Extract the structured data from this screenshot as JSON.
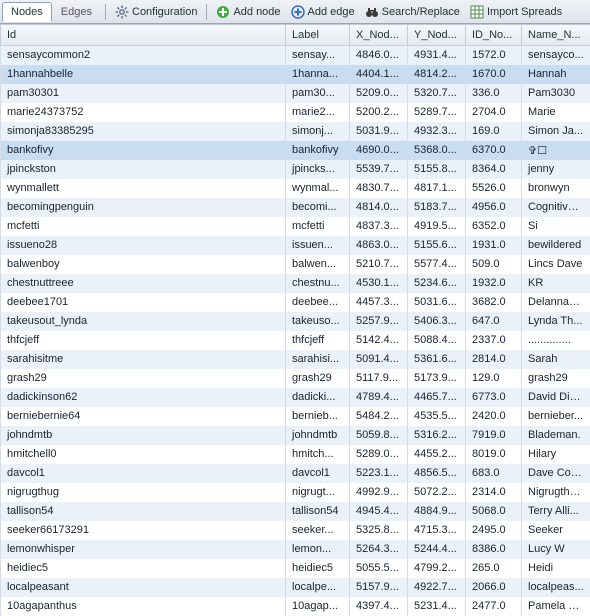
{
  "toolbar": {
    "tabs": {
      "nodes": "Nodes",
      "edges": "Edges"
    },
    "config": "Configuration",
    "addNode": "Add node",
    "addEdge": "Add edge",
    "search": "Search/Replace",
    "import": "Import Spreads"
  },
  "columns": {
    "id": "Id",
    "label": "Label",
    "x": "X_Nod...",
    "y": "Y_Nod...",
    "idno": "ID_No...",
    "name": "Name_N..."
  },
  "rows": [
    {
      "id": "sensaycommon2",
      "label": "sensay...",
      "x": "4846.0...",
      "y": "4931.4...",
      "idno": "1572.0",
      "name": "sensayco..."
    },
    {
      "id": "1hannahbelle",
      "label": "1hanna...",
      "x": "4404.1...",
      "y": "4814.2...",
      "idno": "1670.0",
      "name": "Hannah"
    },
    {
      "id": "pam30301",
      "label": "pam30...",
      "x": "5209.0...",
      "y": "5320.7...",
      "idno": "336.0",
      "name": "Pam3030"
    },
    {
      "id": "marie24373752",
      "label": "marie2...",
      "x": "5200.2...",
      "y": "5289.7...",
      "idno": "2704.0",
      "name": "Marie"
    },
    {
      "id": "simonja83385295",
      "label": "simonj...",
      "x": "5031.9...",
      "y": "4932.3...",
      "idno": "169.0",
      "name": "Simon Ja..."
    },
    {
      "id": "bankofivy",
      "label": "bankofivy",
      "x": "4690.0...",
      "y": "5368.0...",
      "idno": "6370.0",
      "name": "✞☐"
    },
    {
      "id": "jpinckston",
      "label": "jpincks...",
      "x": "5539.7...",
      "y": "5155.8...",
      "idno": "8364.0",
      "name": "jenny"
    },
    {
      "id": "wynmallett",
      "label": "wynmal...",
      "x": "4830.7...",
      "y": "4817.1...",
      "idno": "5526.0",
      "name": "bronwyn"
    },
    {
      "id": "becomingpenguin",
      "label": "becomi...",
      "x": "4814.0...",
      "y": "5183.7...",
      "idno": "4956.0",
      "name": "Cognitive ..."
    },
    {
      "id": "mcfetti",
      "label": "mcfetti",
      "x": "4837.3...",
      "y": "4919.5...",
      "idno": "6352.0",
      "name": "Si"
    },
    {
      "id": "issueno28",
      "label": "issuen...",
      "x": "4863.0...",
      "y": "5155.6...",
      "idno": "1931.0",
      "name": "bewildered"
    },
    {
      "id": "balwenboy",
      "label": "balwen...",
      "x": "5210.7...",
      "y": "5577.4...",
      "idno": "509.0",
      "name": "Lincs Dave"
    },
    {
      "id": "chestnuttreee",
      "label": "chestnu...",
      "x": "4530.1...",
      "y": "5234.6...",
      "idno": "1932.0",
      "name": "KR"
    },
    {
      "id": "deebee1701",
      "label": "deebee...",
      "x": "4457.3...",
      "y": "5031.6...",
      "idno": "3682.0",
      "name": "DelannaM..."
    },
    {
      "id": "takeusout_lynda",
      "label": "takeuso...",
      "x": "5257.9...",
      "y": "5406.3...",
      "idno": "647.0",
      "name": "Lynda Th..."
    },
    {
      "id": "thfcjeff",
      "label": "thfcjeff",
      "x": "5142.4...",
      "y": "5088.4...",
      "idno": "2337.0",
      "name": ".............."
    },
    {
      "id": "sarahisitme",
      "label": "sarahisi...",
      "x": "5091.4...",
      "y": "5361.6...",
      "idno": "2814.0",
      "name": "Sarah"
    },
    {
      "id": "grash29",
      "label": "grash29",
      "x": "5117.9...",
      "y": "5173.9...",
      "idno": "129.0",
      "name": "grash29"
    },
    {
      "id": "dadickinson62",
      "label": "dadicki...",
      "x": "4789.4...",
      "y": "4465.7...",
      "idno": "6773.0",
      "name": "David Dic..."
    },
    {
      "id": "berniebernie64",
      "label": "bernieb...",
      "x": "5484.2...",
      "y": "4535.5...",
      "idno": "2420.0",
      "name": "bernieber..."
    },
    {
      "id": "johndmtb",
      "label": "johndmtb",
      "x": "5059.8...",
      "y": "5316.2...",
      "idno": "7919.0",
      "name": "Blademan."
    },
    {
      "id": "hmitchell0",
      "label": "hmitch...",
      "x": "5289.0...",
      "y": "4455.2...",
      "idno": "8019.0",
      "name": "Hilary"
    },
    {
      "id": "davcol1",
      "label": "davcol1",
      "x": "5223.1...",
      "y": "4856.5...",
      "idno": "683.0",
      "name": "Dave Colli..."
    },
    {
      "id": "nigrugthug",
      "label": "nigrugt...",
      "x": "4992.9...",
      "y": "5072.2...",
      "idno": "2314.0",
      "name": "Nigrugthu..."
    },
    {
      "id": "tallison54",
      "label": "tallison54",
      "x": "4945.4...",
      "y": "4884.9...",
      "idno": "5068.0",
      "name": "Terry Alli..."
    },
    {
      "id": "seeker66173291",
      "label": "seeker...",
      "x": "5325.8...",
      "y": "4715.3...",
      "idno": "2495.0",
      "name": "Seeker"
    },
    {
      "id": "lemonwhisper",
      "label": "lemon...",
      "x": "5264.3...",
      "y": "5244.4...",
      "idno": "8386.0",
      "name": "Lucy W"
    },
    {
      "id": "heidiec5",
      "label": "heidiec5",
      "x": "5055.5...",
      "y": "4799.2...",
      "idno": "265.0",
      "name": "Heidi"
    },
    {
      "id": "localpeasant",
      "label": "localpe...",
      "x": "5157.9...",
      "y": "4922.7...",
      "idno": "2066.0",
      "name": "localpeas..."
    },
    {
      "id": "10agapanthus",
      "label": "10agap...",
      "x": "4397.4...",
      "y": "5231.4...",
      "idno": "2477.0",
      "name": "Pamela M..."
    }
  ],
  "selectedRows": [
    1,
    5
  ]
}
